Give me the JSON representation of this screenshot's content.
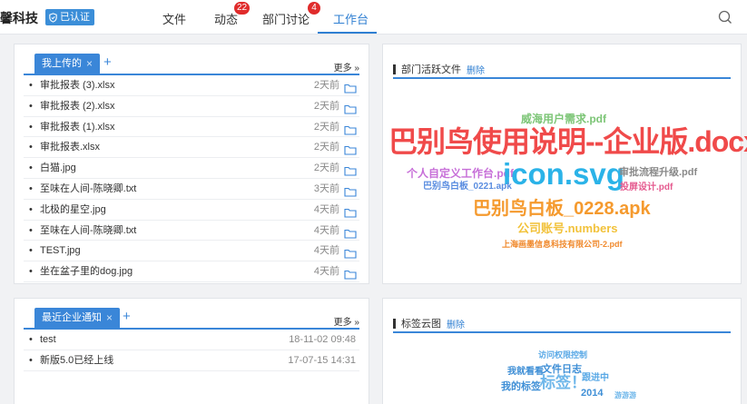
{
  "header": {
    "brand": "馨科技",
    "cert_badge": "已认证",
    "nav": [
      {
        "label": "文件"
      },
      {
        "label": "动态",
        "badge": "22"
      },
      {
        "label": "部门讨论",
        "badge": "4"
      },
      {
        "label": "工作台"
      }
    ],
    "search_icon": "search-icon"
  },
  "uploads_panel": {
    "tab_label": "我上传的",
    "more_label": "更多 »",
    "items": [
      {
        "name": "审批报表 (3).xlsx",
        "time": "2天前"
      },
      {
        "name": "审批报表 (2).xlsx",
        "time": "2天前"
      },
      {
        "name": "审批报表 (1).xlsx",
        "time": "2天前"
      },
      {
        "name": "审批报表.xlsx",
        "time": "2天前"
      },
      {
        "name": "白猫.jpg",
        "time": "2天前"
      },
      {
        "name": "至味在人间-陈晓卿.txt",
        "time": "3天前"
      },
      {
        "name": "北极的星空.jpg",
        "time": "4天前"
      },
      {
        "name": "至味在人间-陈晓卿.txt",
        "time": "4天前"
      },
      {
        "name": "TEST.jpg",
        "time": "4天前"
      },
      {
        "name": "坐在盆子里的dog.jpg",
        "time": "4天前"
      }
    ]
  },
  "notices_panel": {
    "tab_label": "最近企业通知",
    "more_label": "更多 »",
    "items": [
      {
        "name": "test",
        "time": "18-11-02 09:48"
      },
      {
        "name": "新版5.0已经上线",
        "time": "17-07-15 14:31"
      }
    ]
  },
  "active_files_panel": {
    "title": "部门活跃文件",
    "delete_label": "删除",
    "words": [
      {
        "text": "威海用户需求.pdf",
        "color": "#7cc576"
      },
      {
        "text": "巴别鸟使用说明--企业版.docx",
        "color": "#f04a4a"
      },
      {
        "text": "个人自定义工作台.pdf",
        "color": "#c76fd8"
      },
      {
        "text": "icon.svg",
        "color": "#2bb3e8"
      },
      {
        "text": "审批流程升级.pdf",
        "color": "#8a8a8a"
      },
      {
        "text": "巴别鸟白板_0221.apk",
        "color": "#5a8de0"
      },
      {
        "text": "投屏设计.pdf",
        "color": "#e55a8f"
      },
      {
        "text": "巴别鸟白板_0228.apk",
        "color": "#f59a2e"
      },
      {
        "text": "公司账号.numbers",
        "color": "#f2c23b"
      },
      {
        "text": "上海画墨信息科技有限公司-2.pdf",
        "color": "#f08a2e"
      }
    ]
  },
  "tag_cloud_panel": {
    "title": "标签云图",
    "delete_label": "删除",
    "words": [
      {
        "text": "访问权限控制",
        "color": "#5aa9e6"
      },
      {
        "text": "我就看看",
        "color": "#3f8fd6"
      },
      {
        "text": "文件日志",
        "color": "#3f8fd6"
      },
      {
        "text": "跟进中",
        "color": "#5aa9e6"
      },
      {
        "text": "我的标签",
        "color": "#3f8fd6"
      },
      {
        "text": "标签！",
        "color": "#6fb7ea"
      },
      {
        "text": "2014",
        "color": "#3f8fd6"
      },
      {
        "text": "游游游",
        "color": "#6fb7ea"
      }
    ]
  },
  "colors": {
    "accent": "#3a86d8",
    "nav_active": "#2f7fd2",
    "badge": "#e02b2b"
  }
}
